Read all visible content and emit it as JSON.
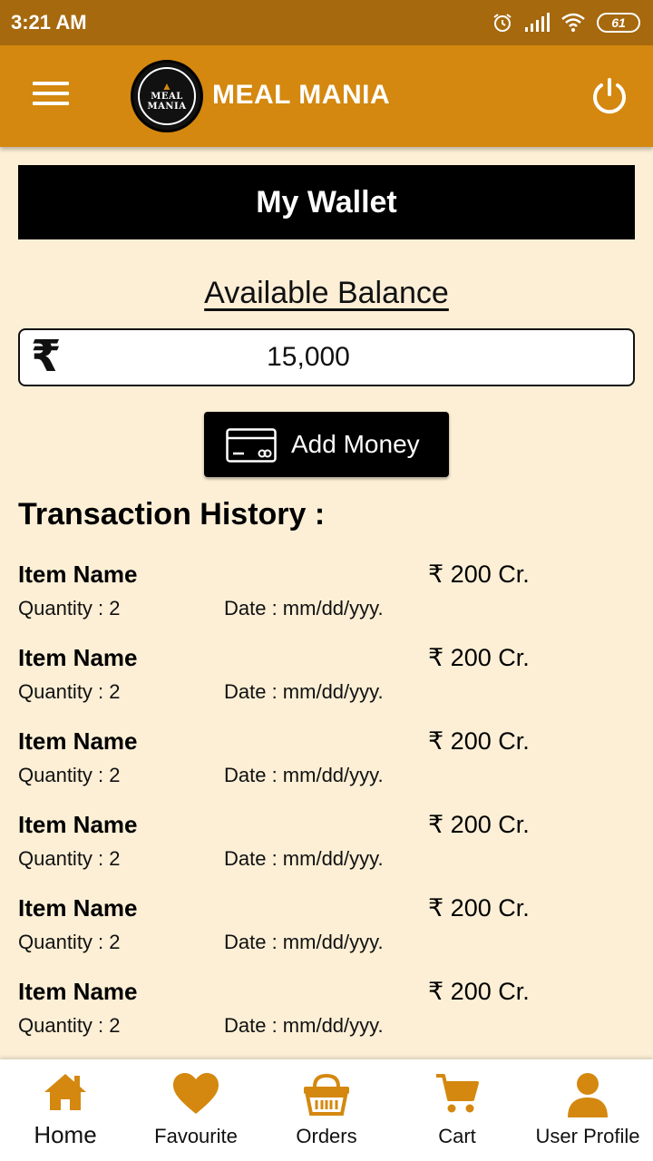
{
  "status_bar": {
    "time": "3:21 AM",
    "battery": "61",
    "icons": [
      "alarm-icon",
      "signal-icon",
      "wifi-icon",
      "battery-icon"
    ]
  },
  "app_bar": {
    "logo_text_line1": "MEAL",
    "logo_text_line2": "MANIA",
    "title": "MEAL MANIA",
    "menu_icon": "hamburger-menu-icon",
    "power_icon": "power-icon"
  },
  "wallet": {
    "header": "My Wallet",
    "balance_label": "Available Balance ",
    "currency_symbol": "₹",
    "balance_value": "15,000",
    "add_money_label": "Add Money"
  },
  "history": {
    "title": "Transaction History :",
    "items": [
      {
        "name": "Item Name",
        "amount": "₹ 200 Cr.",
        "quantity": "Quantity : 2",
        "date": "Date : mm/dd/yyy."
      },
      {
        "name": "Item Name",
        "amount": "₹ 200 Cr.",
        "quantity": "Quantity : 2",
        "date": "Date : mm/dd/yyy."
      },
      {
        "name": "Item Name",
        "amount": "₹ 200 Cr.",
        "quantity": "Quantity : 2",
        "date": "Date : mm/dd/yyy."
      },
      {
        "name": "Item Name",
        "amount": "₹ 200 Cr.",
        "quantity": "Quantity : 2",
        "date": "Date : mm/dd/yyy."
      },
      {
        "name": "Item Name",
        "amount": "₹ 200 Cr.",
        "quantity": "Quantity : 2",
        "date": "Date : mm/dd/yyy."
      },
      {
        "name": "Item Name",
        "amount": "₹ 200 Cr.",
        "quantity": "Quantity : 2",
        "date": "Date : mm/dd/yyy."
      }
    ]
  },
  "bottom_nav": {
    "items": [
      {
        "label": "Home",
        "icon": "home-icon"
      },
      {
        "label": "Favourite",
        "icon": "heart-icon"
      },
      {
        "label": "Orders",
        "icon": "basket-icon"
      },
      {
        "label": "Cart",
        "icon": "cart-icon"
      },
      {
        "label": "User Profile",
        "icon": "user-icon"
      }
    ]
  },
  "colors": {
    "status_bar": "#a6690e",
    "app_bar": "#d4880f",
    "background": "#fcefd6",
    "accent": "#d4880f"
  }
}
